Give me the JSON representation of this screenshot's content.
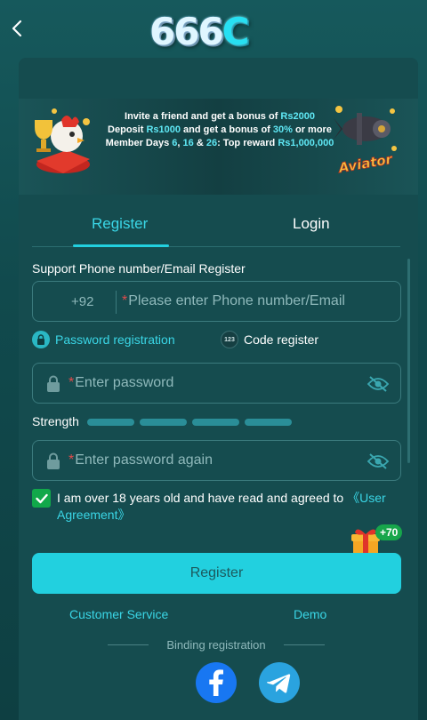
{
  "header": {
    "logo_text": "666",
    "logo_c": "C",
    "back_icon": "chevron-left-icon"
  },
  "banner": {
    "line1_prefix": "Invite a friend and get a bonus of ",
    "line1_amount": "Rs2000",
    "line2_a": "Deposit ",
    "line2_amount": "Rs1000",
    "line2_b": " and get a bonus of ",
    "line2_percent": "30%",
    "line2_c": " or more",
    "line3_a": "Member Days ",
    "line3_d1": "6",
    "line3_sep1": ", ",
    "line3_d2": "16",
    "line3_sep2": " & ",
    "line3_d3": "26",
    "line3_b": ": Top reward ",
    "line3_amount": "Rs1,000,000",
    "right_badge": "Aviator"
  },
  "tabs": {
    "register": "Register",
    "login": "Login",
    "active": "register"
  },
  "form": {
    "section_title": "Support Phone number/Email Register",
    "country_code": "+92",
    "phone_placeholder": "Please enter Phone number/Email",
    "required_mark": "*",
    "mode_password": "Password registration",
    "mode_code": "Code register",
    "mode_code_icon_text": "123",
    "password_placeholder": "Enter password",
    "strength_label": "Strength",
    "strength_level": 0,
    "strength_segments": 4,
    "password_again_placeholder": "Enter password again",
    "agree_text": "I am over 18 years old and have read and agreed to ",
    "agree_link": "《User Agreement》",
    "agree_checked": true,
    "gift_badge": "+70",
    "register_button": "Register"
  },
  "footer": {
    "customer_service": "Customer Service",
    "demo": "Demo",
    "binding_label": "Binding registration",
    "social": [
      "facebook-icon",
      "telegram-icon"
    ]
  },
  "colors": {
    "accent": "#22d0df",
    "background": "#154c4f",
    "check": "#11a84a"
  }
}
